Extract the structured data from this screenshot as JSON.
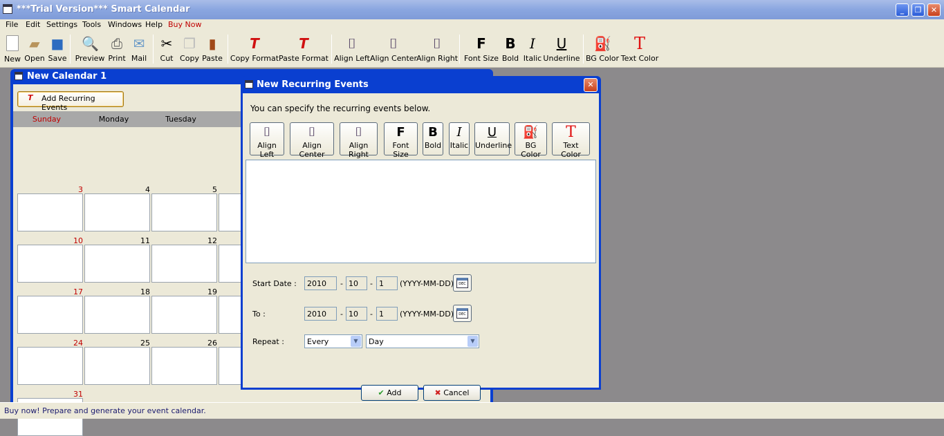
{
  "app": {
    "title": "***Trial Version*** Smart Calendar"
  },
  "menu": [
    "File",
    "Edit",
    "Settings",
    "Tools",
    "Windows",
    "Help",
    "Buy Now"
  ],
  "toolbar": [
    "New",
    "Open",
    "Save",
    "Preview",
    "Print",
    "Mail",
    "Cut",
    "Copy",
    "Paste",
    "Copy Format",
    "Paste Format",
    "Align Left",
    "Align Center",
    "Align Right",
    "Font Size",
    "Bold",
    "Italic",
    "Underline",
    "BG Color",
    "Text Color"
  ],
  "calendar": {
    "title": "New Calendar 1",
    "add_button": "Add Recurring Events",
    "days": [
      "Sunday",
      "Monday",
      "Tuesday",
      "We"
    ],
    "rows": [
      [
        "3",
        "4",
        "5"
      ],
      [
        "10",
        "11",
        "12"
      ],
      [
        "17",
        "18",
        "19"
      ],
      [
        "24",
        "25",
        "26"
      ],
      [
        "31"
      ]
    ]
  },
  "dialog": {
    "title": "New Recurring Events",
    "instructions": "You can specify the recurring events below.",
    "format_buttons": [
      "Align Left",
      "Align Center",
      "Align Right",
      "Font Size",
      "Bold",
      "Italic",
      "Underline",
      "BG Color",
      "Text Color"
    ],
    "start_label": "Start Date :",
    "to_label": "To :",
    "repeat_label": "Repeat :",
    "dash": "-",
    "format_hint": "(YYYY-MM-DD)",
    "cal_icon_text": "DEC",
    "start": {
      "year": "2010",
      "month": "10",
      "day": "1"
    },
    "to": {
      "year": "2010",
      "month": "10",
      "day": "1"
    },
    "repeat_every": "Every",
    "repeat_unit": "Day",
    "add": "Add",
    "cancel": "Cancel"
  },
  "status": "Buy now! Prepare and generate your event calendar.",
  "colors": {
    "sunday": "#c00000",
    "buy_now": "#c00000",
    "title_blue": "#0a3fd0"
  }
}
